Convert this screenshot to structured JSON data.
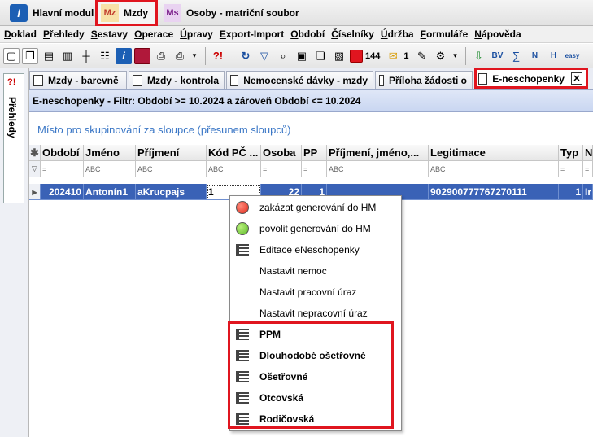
{
  "modules": {
    "main": "Hlavní modul",
    "mzdy": "Mzdy",
    "mzdy_icon": "Mz",
    "osoby": "Osoby - matriční soubor",
    "osoby_icon": "Ms"
  },
  "menu": [
    "Doklad",
    "Přehledy",
    "Sestavy",
    "Operace",
    "Úpravy",
    "Export-Import",
    "Období",
    "Číselníky",
    "Údržba",
    "Formuláře",
    "Nápověda"
  ],
  "toolbar": {
    "count1": "144",
    "count2": "1"
  },
  "left_panel": {
    "label": "Přehledy",
    "icon": "?!"
  },
  "tabs": [
    {
      "label": "Mzdy - barevně"
    },
    {
      "label": "Mzdy - kontrola"
    },
    {
      "label": "Nemocenské dávky - mzdy"
    },
    {
      "label": "Příloha žádosti o"
    },
    {
      "label": "E-neschopenky"
    }
  ],
  "filter_text": "E-neschopenky  -  Filtr: Období >= 10.2024  a zároveň  Období <= 10.2024",
  "group_placeholder": "Místo pro skupinování za sloupce (přesunem sloupců)",
  "columns": [
    "Období",
    "Jméno",
    "Příjmení",
    "Kód PČ ...",
    "Osoba",
    "PP",
    "Příjmení, jméno,...",
    "Legitimace",
    "Typ",
    "N"
  ],
  "filter_row": [
    "=",
    "ABC",
    "ABC",
    "ABC",
    "=",
    "=",
    "ABC",
    "ABC",
    "=",
    "="
  ],
  "row": [
    "202410",
    "Antonín1",
    "aKrucpajs",
    "1",
    "22",
    "1",
    "",
    "902900777767270111",
    "1",
    "Ir"
  ],
  "context_menu": [
    {
      "label": "zakázat generování do HM",
      "icon": "red-circle"
    },
    {
      "label": "povolit generování do HM",
      "icon": "green-circle"
    },
    {
      "label": "Editace eNeschopenky",
      "icon": "list"
    },
    {
      "label": "Nastavit nemoc",
      "icon": ""
    },
    {
      "label": "Nastavit pracovní úraz",
      "icon": ""
    },
    {
      "label": "Nastavit nepracovní úraz",
      "icon": ""
    },
    {
      "label": "PPM",
      "icon": "list"
    },
    {
      "label": "Dlouhodobé ošetřovné",
      "icon": "list"
    },
    {
      "label": "Ošetřovné",
      "icon": "list"
    },
    {
      "label": "Otcovská",
      "icon": "list"
    },
    {
      "label": "Rodičovská",
      "icon": "list"
    }
  ],
  "colors": {
    "highlight": "#e0151f",
    "selection": "#3a62b6",
    "group_text": "#3b77c6"
  }
}
